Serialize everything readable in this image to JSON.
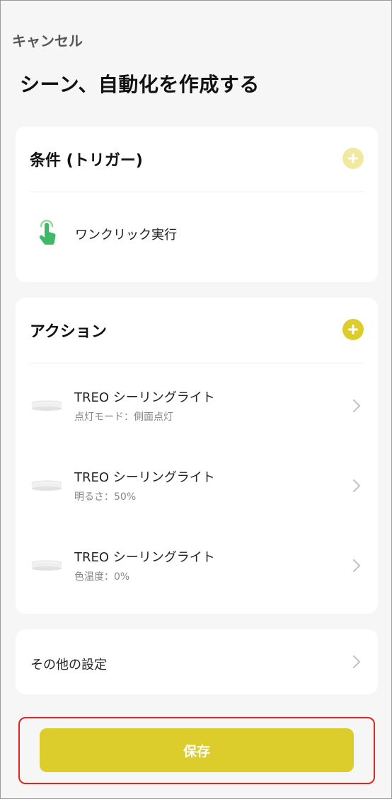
{
  "header": {
    "cancel_label": "キャンセル",
    "title": "シーン、自動化を作成する"
  },
  "conditions": {
    "title": "条件 (トリガー)",
    "add_icon": "plus-circle-icon",
    "add_color": "#f1ea9e",
    "trigger": {
      "icon": "tap-hand-icon",
      "label": "ワンクリック実行"
    }
  },
  "actions": {
    "title": "アクション",
    "add_icon": "plus-circle-icon",
    "add_color": "#dccd2d",
    "items": [
      {
        "title": "TREO シーリングライト",
        "detail": "点灯モード：側面点灯"
      },
      {
        "title": "TREO シーリングライト",
        "detail": "明るさ：50%"
      },
      {
        "title": "TREO シーリングライト",
        "detail": "色温度：0%"
      }
    ]
  },
  "other_settings": {
    "label": "その他の設定"
  },
  "footer": {
    "save_label": "保存",
    "save_color": "#dccd2d",
    "highlight_color": "#e3241b"
  }
}
